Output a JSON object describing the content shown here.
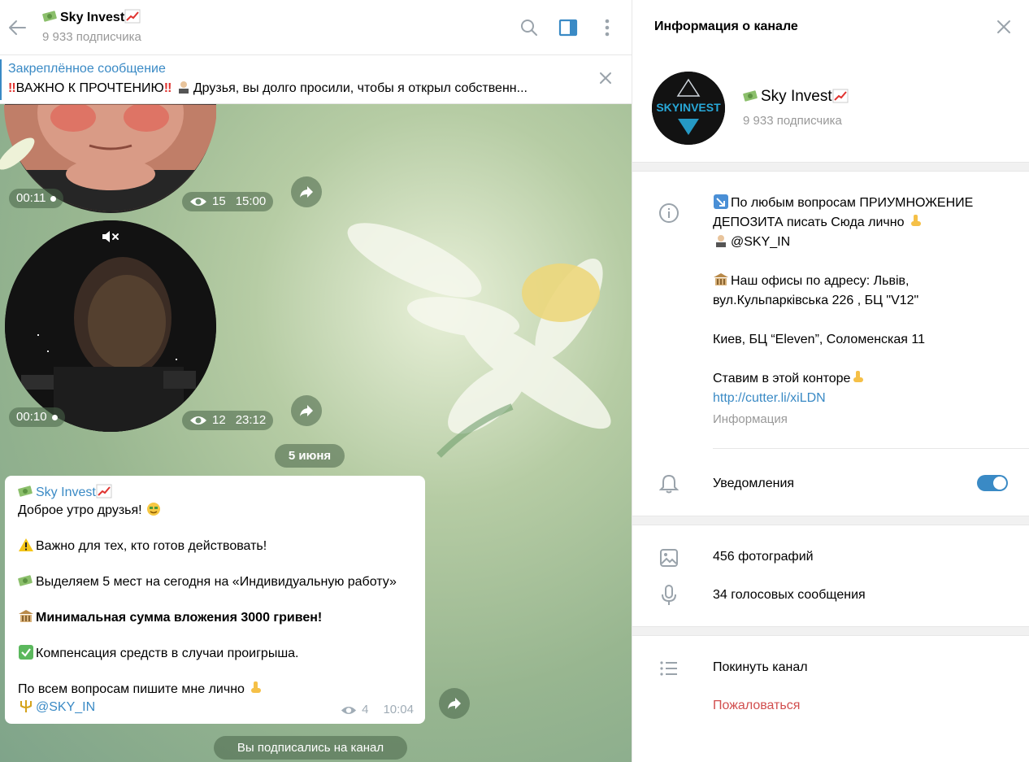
{
  "chat": {
    "title": "Sky Invest",
    "subscribers": "9 933 подписчика",
    "pinned": {
      "title": "Закреплённое сообщение",
      "text_a": "ВАЖНО К ПРОЧТЕНИЮ",
      "text_b": "Друзья, вы долго просили, чтобы я открыл собственн..."
    },
    "videos": [
      {
        "duration": "00:11",
        "views": "15",
        "time": "15:00"
      },
      {
        "duration": "00:10",
        "views": "12",
        "time": "23:12"
      }
    ],
    "date_separator": "5 июня",
    "message": {
      "author": "Sky Invest",
      "greeting": "Доброе утро друзья!",
      "line1": "Важно для тех, кто готов действовать!",
      "line2": "Выделяем 5 мест на сегодня на  «Индивидуальную работу»",
      "line3": "Минимальная сумма вложения 3000 гривен!",
      "line4": "Компенсация средств в случаи проигрыша.",
      "line5": "По всем вопросам пишите мне лично",
      "mention": "@SKY_IN",
      "views": "4",
      "time": "10:04"
    },
    "service_message": "Вы подписались на канал"
  },
  "info": {
    "header": "Информация о канале",
    "name": "Sky Invest",
    "subscribers": "9 933 подписчика",
    "avatar_text": "SKYINVEST",
    "description": {
      "l1": "По любым вопросам ПРИУМНОЖЕНИЕ",
      "l2": "ДЕПОЗИТА писать Сюда лично",
      "l3": "@SKY_IN",
      "l4": "Наш офисы по адресу: Львів,",
      "l5": "вул.Кульпарківська 226 , БЦ \"V12\"",
      "l6": "Киев, БЦ “Eleven”, Соломенская 11",
      "l7": "Ставим в этой конторе",
      "link": "http://cutter.li/xiLDN",
      "caption": "Информация"
    },
    "notifications_label": "Уведомления",
    "notifications_on": true,
    "photos": "456 фотографий",
    "voices": "34 голосовых сообщения",
    "leave": "Покинуть канал",
    "report": "Пожаловаться"
  },
  "colors": {
    "accent": "#3a8ac5",
    "danger": "#d14e4e",
    "muted": "#999999"
  },
  "icons": [
    "back-arrow-icon",
    "search-icon",
    "sidebar-toggle-icon",
    "more-vert-icon",
    "close-icon",
    "eye-icon",
    "share-icon",
    "mute-icon",
    "info-icon",
    "bell-icon",
    "photo-icon",
    "mic-icon",
    "list-icon"
  ]
}
